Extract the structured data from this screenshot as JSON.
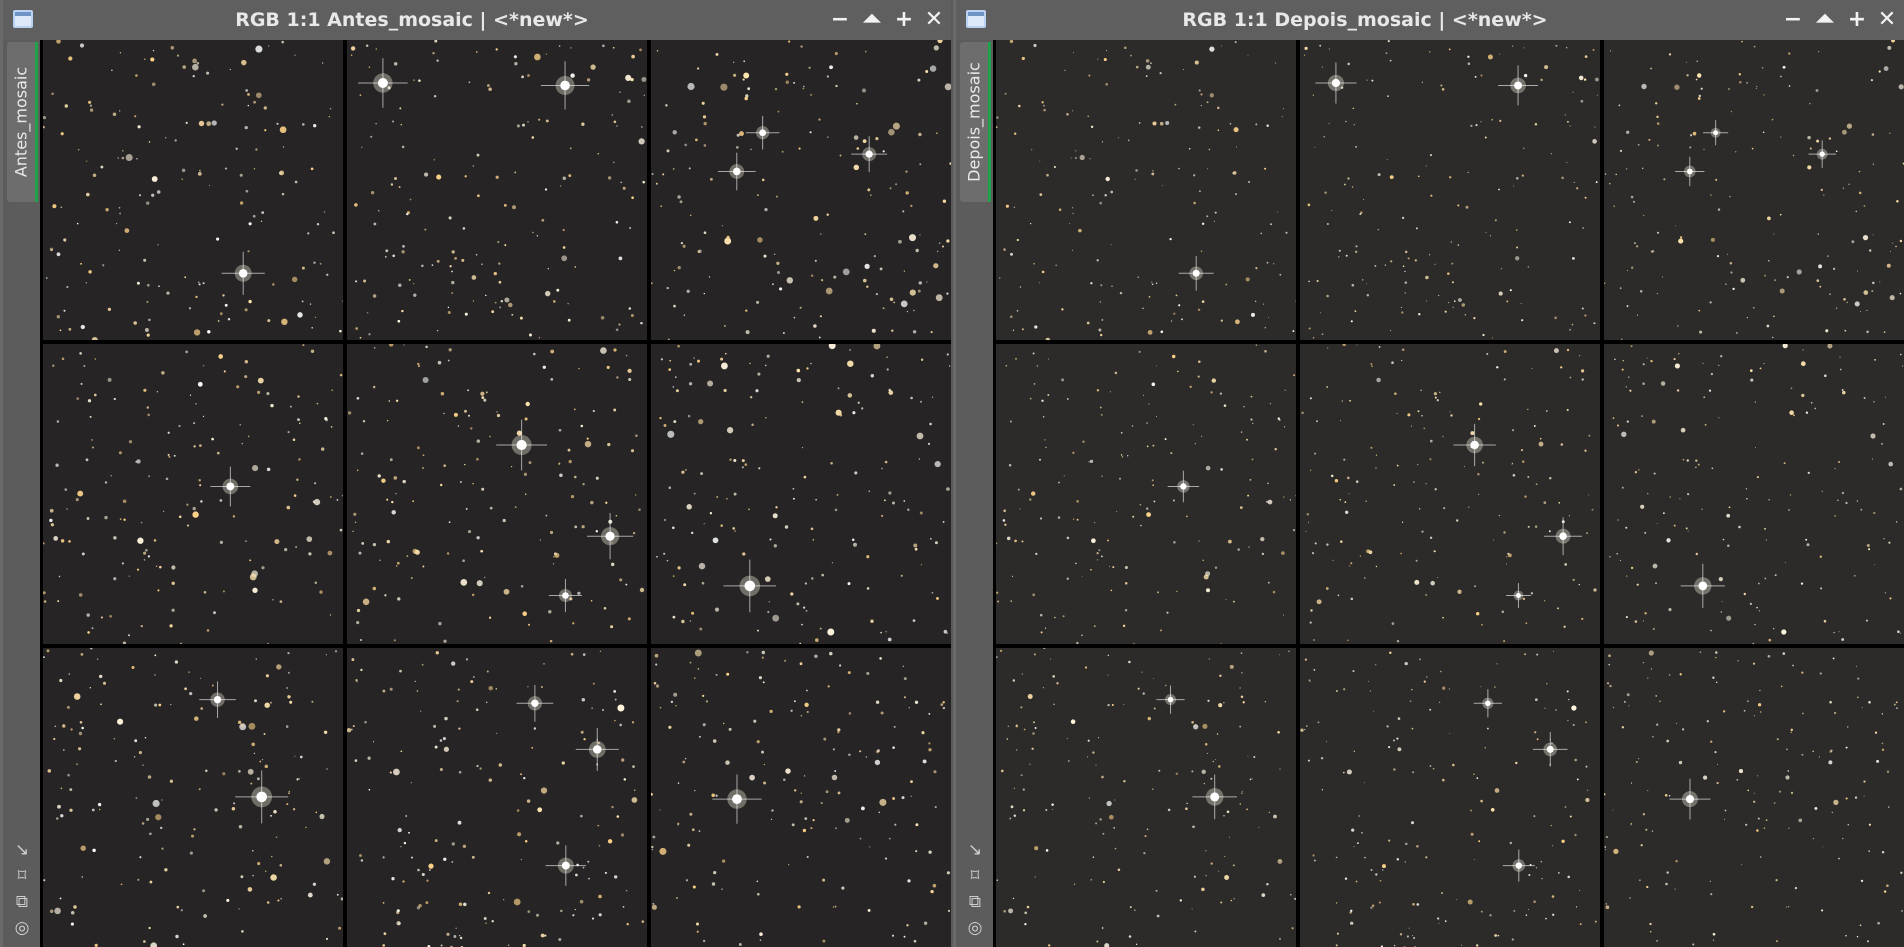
{
  "windows": [
    {
      "id": "left",
      "title": "RGB 1:1 Antes_mosaic | <*new*>",
      "sidebar_tab": "Antes_mosaic",
      "icons": {
        "window": "window-icon",
        "minimize": "minimize-icon",
        "shade": "shade-icon",
        "maximize": "plus-icon",
        "close": "close-icon"
      },
      "controls": {
        "minimize": "−",
        "shade": "⏶",
        "maximize": "+",
        "close": "✕"
      },
      "tools": [
        "↘",
        "⌑",
        "⧉",
        "◎"
      ],
      "seed": 11
    },
    {
      "id": "right",
      "title": "RGB 1:1 Depois_mosaic | <*new*>",
      "sidebar_tab": "Depois_mosaic",
      "icons": {
        "window": "window-icon",
        "minimize": "minimize-icon",
        "shade": "shade-icon",
        "maximize": "plus-icon",
        "close": "close-icon"
      },
      "controls": {
        "minimize": "−",
        "shade": "⏶",
        "maximize": "+",
        "close": "✕"
      },
      "tools": [
        "↘",
        "⌑",
        "⧉",
        "◎"
      ],
      "seed": 11
    }
  ],
  "colors": {
    "titlebar": "#5f5f5f",
    "title_text": "#e8e8e8",
    "active_tab_accent": "#1fa34a",
    "sky_before": "#262424",
    "sky_after": "#2c2b2a"
  }
}
